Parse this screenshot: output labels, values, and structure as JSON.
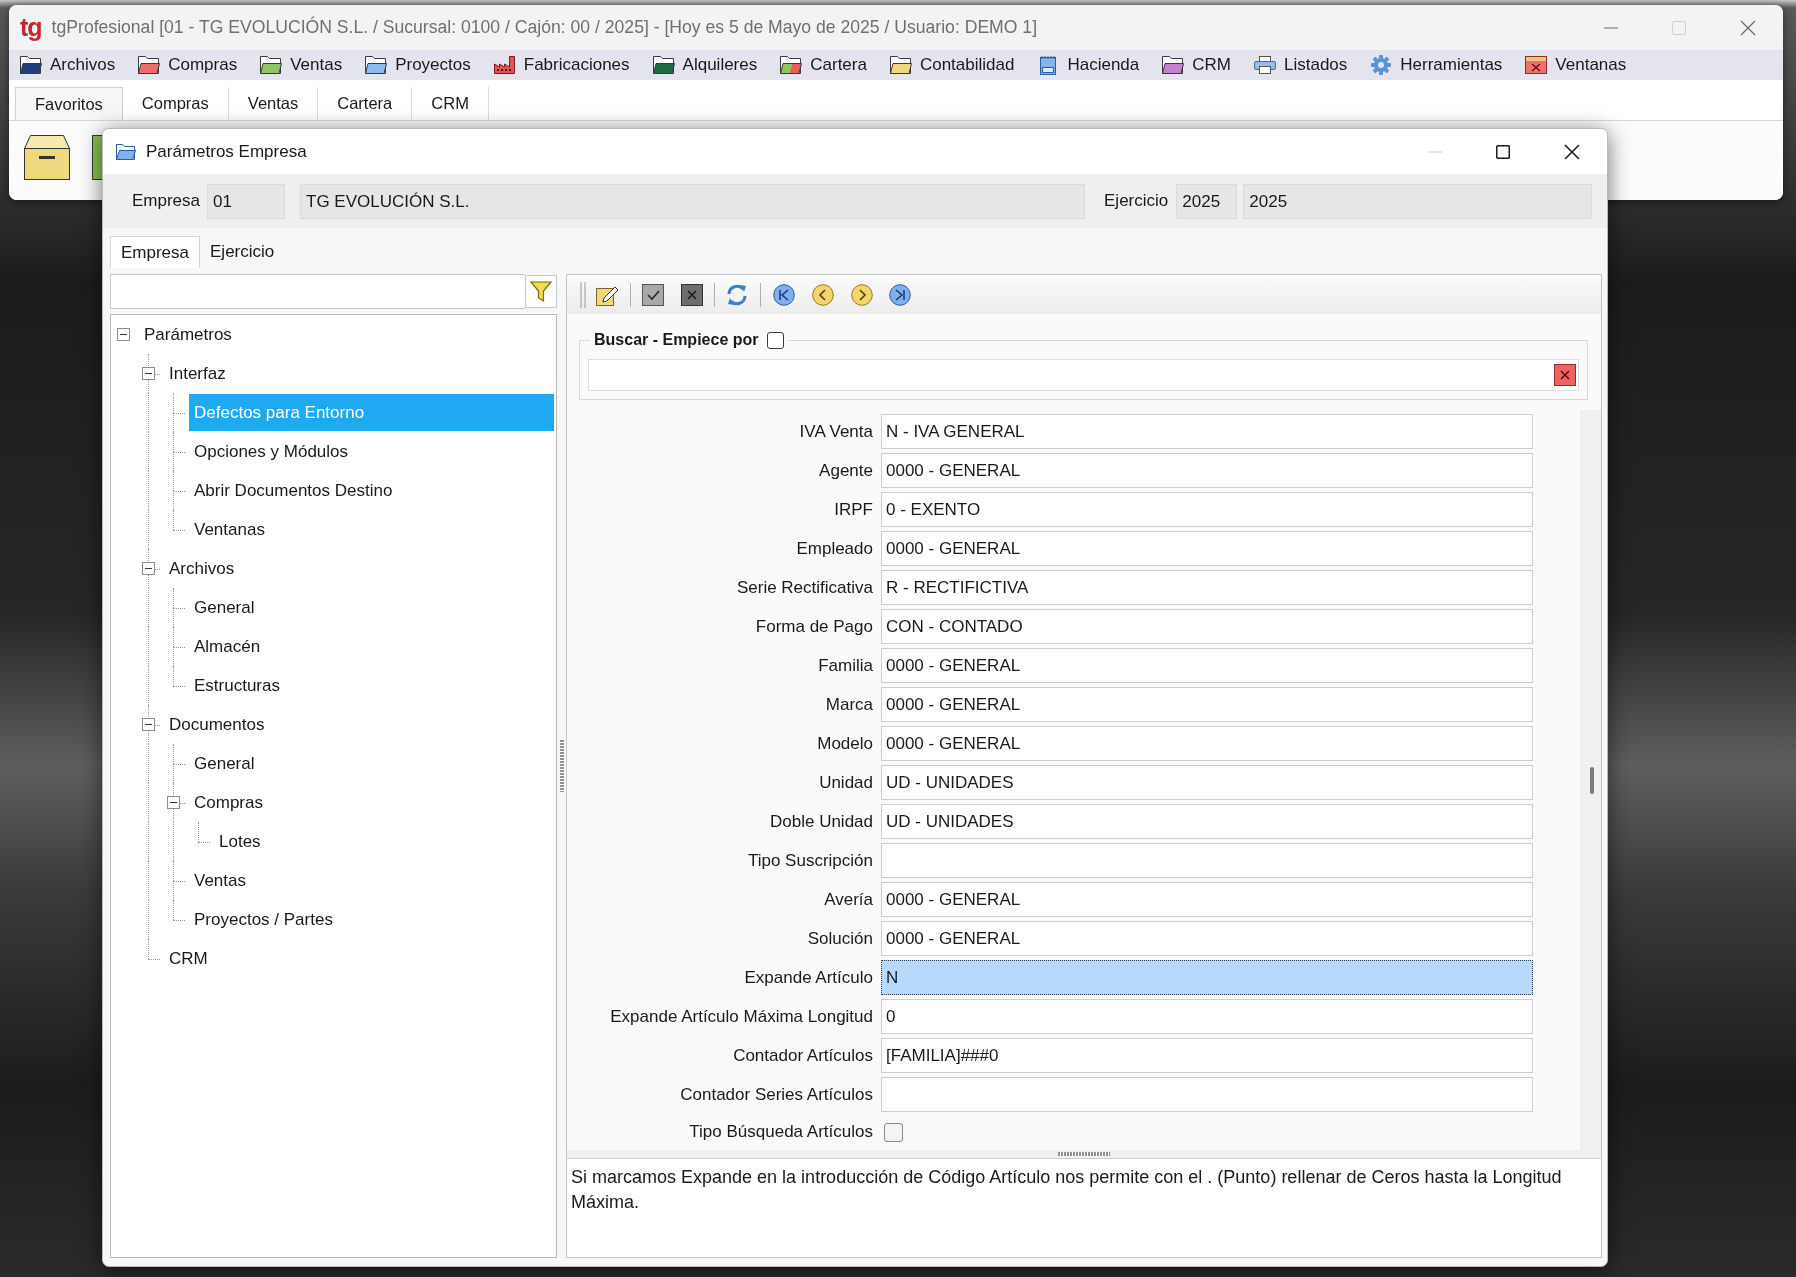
{
  "main_window": {
    "logo": "tg",
    "title": "tgProfesional [01 - TG EVOLUCIÓN S.L. / Sucursal: 0100 / Cajón: 00 / 2025] - [Hoy es 5 de Mayo de 2025 / Usuario: DEMO 1]",
    "maximize_disabled": true
  },
  "menu": [
    {
      "label": "Archivos",
      "kind": "folder",
      "color": "#1d3f7c"
    },
    {
      "label": "Compras",
      "kind": "folder",
      "color": "#f26b6b"
    },
    {
      "label": "Ventas",
      "kind": "folder",
      "color": "#8cc760"
    },
    {
      "label": "Proyectos",
      "kind": "folder",
      "color": "#8dbaf0"
    },
    {
      "label": "Fabricaciones",
      "kind": "factory"
    },
    {
      "label": "Alquileres",
      "kind": "folder",
      "color": "#1f6a44"
    },
    {
      "label": "Cartera",
      "kind": "split-folder",
      "color": "#e8605a"
    },
    {
      "label": "Contabilidad",
      "kind": "folder",
      "color": "#f3d77a"
    },
    {
      "label": "Hacienda",
      "kind": "tax-form"
    },
    {
      "label": "CRM",
      "kind": "folder",
      "color": "#c67fd1"
    },
    {
      "label": "Listados",
      "kind": "printer"
    },
    {
      "label": "Herramientas",
      "kind": "gear"
    },
    {
      "label": "Ventanas",
      "kind": "window"
    }
  ],
  "tabs": [
    {
      "label": "Favoritos",
      "selected": true
    },
    {
      "label": "Compras",
      "selected": false
    },
    {
      "label": "Ventas",
      "selected": false
    },
    {
      "label": "Cartera",
      "selected": false
    },
    {
      "label": "CRM",
      "selected": false
    }
  ],
  "dialog": {
    "title": "Parámetros Empresa",
    "minimize_disabled": true,
    "header": {
      "company_label": "Empresa",
      "company_code": "01",
      "company_name": "TG EVOLUCIÓN S.L.",
      "year_label": "Ejercicio",
      "year_code": "2025",
      "year_name": "2025"
    },
    "tabs": [
      {
        "label": "Empresa",
        "selected": true
      },
      {
        "label": "Ejercicio",
        "selected": false
      }
    ],
    "tree": [
      {
        "label": "Parámetros",
        "expanded": true,
        "selected": false,
        "children": [
          {
            "label": "Interfaz",
            "expanded": true,
            "selected": false,
            "children": [
              {
                "label": "Defectos para Entorno",
                "selected": true
              },
              {
                "label": "Opciones y Módulos",
                "selected": false
              },
              {
                "label": "Abrir Documentos Destino",
                "selected": false
              },
              {
                "label": "Ventanas",
                "selected": false
              }
            ]
          },
          {
            "label": "Archivos",
            "expanded": true,
            "selected": false,
            "children": [
              {
                "label": "General",
                "selected": false
              },
              {
                "label": "Almacén",
                "selected": false
              },
              {
                "label": "Estructuras",
                "selected": false
              }
            ]
          },
          {
            "label": "Documentos",
            "expanded": true,
            "selected": false,
            "children": [
              {
                "label": "General",
                "selected": false
              },
              {
                "label": "Compras",
                "expanded": true,
                "selected": false,
                "children": [
                  {
                    "label": "Lotes",
                    "selected": false
                  }
                ]
              },
              {
                "label": "Ventas",
                "selected": false
              },
              {
                "label": "Proyectos / Partes",
                "selected": false
              }
            ]
          },
          {
            "label": "CRM",
            "selected": false
          }
        ]
      }
    ],
    "search": {
      "label": "Buscar - Empiece por",
      "starts_with": false
    },
    "fields": [
      {
        "label": "IVA Venta",
        "kind": "text",
        "value": "N - IVA GENERAL",
        "selected": false
      },
      {
        "label": "Agente",
        "kind": "text",
        "value": "0000 - GENERAL",
        "selected": false
      },
      {
        "label": "IRPF",
        "kind": "text",
        "value": "0 - EXENTO",
        "selected": false
      },
      {
        "label": "Empleado",
        "kind": "text",
        "value": "0000 - GENERAL",
        "selected": false
      },
      {
        "label": "Serie Rectificativa",
        "kind": "text",
        "value": "R - RECTIFICTIVA",
        "selected": false
      },
      {
        "label": "Forma de Pago",
        "kind": "text",
        "value": "CON - CONTADO",
        "selected": false
      },
      {
        "label": "Familia",
        "kind": "text",
        "value": "0000 - GENERAL",
        "selected": false
      },
      {
        "label": "Marca",
        "kind": "text",
        "value": "0000 - GENERAL",
        "selected": false
      },
      {
        "label": "Modelo",
        "kind": "text",
        "value": "0000 - GENERAL",
        "selected": false
      },
      {
        "label": "Unidad",
        "kind": "text",
        "value": "UD - UNIDADES",
        "selected": false
      },
      {
        "label": "Doble Unidad",
        "kind": "text",
        "value": "UD - UNIDADES",
        "selected": false
      },
      {
        "label": "Tipo Suscripción",
        "kind": "text",
        "selected": false
      },
      {
        "label": "Avería",
        "kind": "text",
        "value": "0000 - GENERAL",
        "selected": false
      },
      {
        "label": "Solución",
        "kind": "text",
        "value": "0000 - GENERAL",
        "selected": false
      },
      {
        "label": "Expande Artículo",
        "kind": "text",
        "value": "N",
        "selected": true
      },
      {
        "label": "Expande Artículo Máxima Longitud",
        "kind": "text",
        "value": "0",
        "selected": false
      },
      {
        "label": "Contador Artículos",
        "kind": "text",
        "value": "[FAMILIA]###0",
        "selected": false
      },
      {
        "label": "Contador Series Artículos",
        "kind": "text",
        "selected": false
      },
      {
        "label": "Tipo Búsqueda Artículos",
        "kind": "checkbox",
        "checked": false,
        "selected": false
      }
    ],
    "description": "Si marcamos Expande en la introducción de Código Artículo nos permite con el . (Punto) rellenar de Ceros hasta la Longitud Máxima."
  }
}
